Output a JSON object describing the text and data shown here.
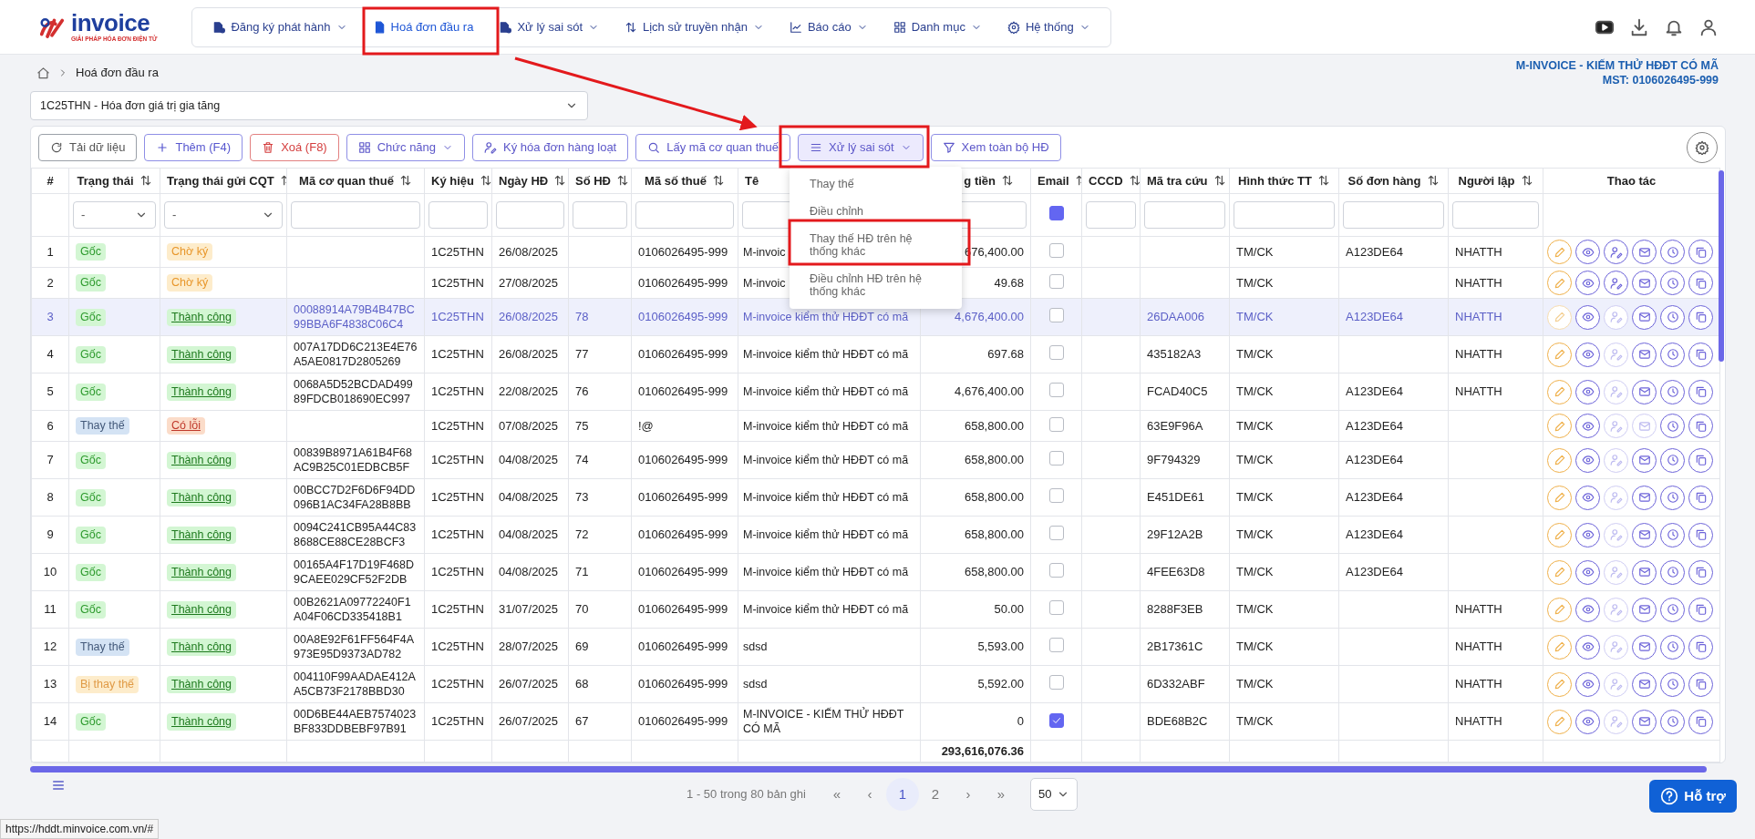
{
  "logo": {
    "name": "invoice",
    "tagline": "GIẢI PHÁP HÓA ĐƠN ĐIỆN TỬ"
  },
  "nav": [
    {
      "label": "Đăng ký phát hành",
      "caret": true,
      "selected": false
    },
    {
      "label": "Hoá đơn đầu ra",
      "caret": false,
      "selected": true
    },
    {
      "label": "Xử lý sai sót",
      "caret": true,
      "selected": false
    },
    {
      "label": "Lịch sử truyền nhận",
      "caret": true,
      "selected": false
    },
    {
      "label": "Báo cáo",
      "caret": true,
      "selected": false
    },
    {
      "label": "Danh mục",
      "caret": true,
      "selected": false
    },
    {
      "label": "Hệ thống",
      "caret": true,
      "selected": false
    }
  ],
  "breadcrumb": [
    "Hoá đơn đầu ra"
  ],
  "company": {
    "name": "M-INVOICE - KIẾM THỬ HĐĐT CÓ MÃ",
    "tax_id": "MST: 0106026495-999"
  },
  "series_select": {
    "value": "1C25THN - Hóa đơn giá trị gia tăng"
  },
  "toolbar": [
    {
      "label": "Tải dữ liệu",
      "kind": "reload"
    },
    {
      "label": "Thêm (F4)",
      "kind": "add"
    },
    {
      "label": "Xoá (F8)",
      "kind": "delete"
    },
    {
      "label": "Chức năng",
      "kind": "functions",
      "expanded": false
    },
    {
      "label": "Ký hóa đơn hàng loạt",
      "kind": "sign"
    },
    {
      "label": "Lấy mã cơ quan thuế",
      "kind": "search"
    },
    {
      "label": "Xử lý sai sót",
      "kind": "errors",
      "expanded": true,
      "menu": [
        "Thay thế",
        "Điều chỉnh",
        "Thay thế HĐ trên hệ thống khác",
        "Điều chỉnh HĐ trên hệ thống khác"
      ]
    },
    {
      "label": "Xem toàn bộ HĐ",
      "kind": "filter"
    }
  ],
  "table": {
    "columns": [
      {
        "label": "#",
        "sortable": false
      },
      {
        "label": "Trạng thái",
        "sortable": true
      },
      {
        "label": "Trạng thái gửi CQT",
        "sortable": true
      },
      {
        "label": "Mã cơ quan thuế",
        "sortable": true
      },
      {
        "label": "Ký hiệu",
        "sortable": true
      },
      {
        "label": "Ngày HĐ",
        "sortable": true
      },
      {
        "label": "Số HĐ",
        "sortable": true
      },
      {
        "label": "Mã số thuế",
        "sortable": true
      },
      {
        "label": "Tê",
        "sortable": false
      },
      {
        "label": "g tiền",
        "sortable": true
      },
      {
        "label": "Email",
        "sortable": true
      },
      {
        "label": "CCCD",
        "sortable": true
      },
      {
        "label": "Mã tra cứu",
        "sortable": true
      },
      {
        "label": "Hình thức TT",
        "sortable": true
      },
      {
        "label": "Số đơn hàng",
        "sortable": true
      },
      {
        "label": "Người lập",
        "sortable": true
      },
      {
        "label": "Thao tác",
        "sortable": false
      }
    ],
    "filters": {
      "status": "-",
      "cqt": "-",
      "email_indeterminate": true
    },
    "rows": [
      {
        "no": "1",
        "selected": false,
        "status": {
          "label": "Gốc",
          "kind": "original"
        },
        "cqt": {
          "label": "Chờ ký",
          "kind": "pending"
        },
        "symbol": "1C25THN",
        "date": "26/08/2025",
        "tax_id": "0106026495-999",
        "name": "M-invoic",
        "amount": "676,400.00",
        "email": false,
        "payment": "TM/CK",
        "order_no": "A123DE64",
        "creator": "NHATTH",
        "edit_disabled": false,
        "sign_disabled": false,
        "email_disabled": false
      },
      {
        "no": "2",
        "selected": false,
        "status": {
          "label": "Gốc",
          "kind": "original"
        },
        "cqt": {
          "label": "Chờ ký",
          "kind": "pending"
        },
        "symbol": "1C25THN",
        "date": "27/08/2025",
        "tax_id": "0106026495-999",
        "name": "M-invoic",
        "amount": "49.68",
        "email": false,
        "payment": "TM/CK",
        "creator": "NHATTH",
        "edit_disabled": false,
        "sign_disabled": false,
        "email_disabled": false
      },
      {
        "no": "3",
        "selected": true,
        "status": {
          "label": "Gốc",
          "kind": "original"
        },
        "cqt": {
          "label": "Thành công",
          "kind": "success"
        },
        "authority_code": "00088914A79B4B47BC99BBA6F4838C06C4",
        "symbol": "1C25THN",
        "date": "26/08/2025",
        "number": "78",
        "tax_id": "0106026495-999",
        "name": "M-invoice kiểm thử HĐĐT có mã",
        "amount": "4,676,400.00",
        "email": false,
        "lookup": "26DAA006",
        "payment": "TM/CK",
        "order_no": "A123DE64",
        "creator": "NHATTH",
        "edit_disabled": true,
        "sign_disabled": true,
        "email_disabled": false
      },
      {
        "no": "4",
        "selected": false,
        "status": {
          "label": "Gốc",
          "kind": "original"
        },
        "cqt": {
          "label": "Thành công",
          "kind": "success"
        },
        "authority_code": "007A17DD6C213E4E76A5AE0817D2805269",
        "symbol": "1C25THN",
        "date": "26/08/2025",
        "number": "77",
        "tax_id": "0106026495-999",
        "name": "M-invoice kiểm thử HĐĐT có mã",
        "amount": "697.68",
        "email": false,
        "lookup": "435182A3",
        "payment": "TM/CK",
        "creator": "NHATTH",
        "edit_disabled": false,
        "sign_disabled": true,
        "email_disabled": false
      },
      {
        "no": "5",
        "selected": false,
        "status": {
          "label": "Gốc",
          "kind": "original"
        },
        "cqt": {
          "label": "Thành công",
          "kind": "success"
        },
        "authority_code": "0068A5D52BCDAD49989FDCB018690EC997",
        "symbol": "1C25THN",
        "date": "22/08/2025",
        "number": "76",
        "tax_id": "0106026495-999",
        "name": "M-invoice kiểm thử HĐĐT có mã",
        "amount": "4,676,400.00",
        "email": false,
        "lookup": "FCAD40C5",
        "payment": "TM/CK",
        "order_no": "A123DE64",
        "creator": "NHATTH",
        "edit_disabled": false,
        "sign_disabled": true,
        "email_disabled": false
      },
      {
        "no": "6",
        "selected": false,
        "status": {
          "label": "Thay thế",
          "kind": "replacement"
        },
        "cqt": {
          "label": "Có lỗi",
          "kind": "error"
        },
        "symbol": "1C25THN",
        "date": "07/08/2025",
        "number": "75",
        "tax_id": "!@",
        "name": "M-invoice kiểm thử HĐĐT có mã",
        "amount": "658,800.00",
        "email": false,
        "lookup": "63E9F96A",
        "payment": "TM/CK",
        "order_no": "A123DE64",
        "edit_disabled": false,
        "sign_disabled": true,
        "email_disabled": true
      },
      {
        "no": "7",
        "selected": false,
        "status": {
          "label": "Gốc",
          "kind": "original"
        },
        "cqt": {
          "label": "Thành công",
          "kind": "success"
        },
        "authority_code": "00839B8971A61B4F68AC9B25C01EDBCB5F",
        "symbol": "1C25THN",
        "date": "04/08/2025",
        "number": "74",
        "tax_id": "0106026495-999",
        "name": "M-invoice kiểm thử HĐĐT có mã",
        "amount": "658,800.00",
        "email": false,
        "lookup": "9F794329",
        "payment": "TM/CK",
        "order_no": "A123DE64",
        "edit_disabled": false,
        "sign_disabled": true,
        "email_disabled": false
      },
      {
        "no": "8",
        "selected": false,
        "status": {
          "label": "Gốc",
          "kind": "original"
        },
        "cqt": {
          "label": "Thành công",
          "kind": "success"
        },
        "authority_code": "00BCC7D2F6D6F94DD096B1AC34FA28B8BB",
        "symbol": "1C25THN",
        "date": "04/08/2025",
        "number": "73",
        "tax_id": "0106026495-999",
        "name": "M-invoice kiểm thử HĐĐT có mã",
        "amount": "658,800.00",
        "email": false,
        "lookup": "E451DE61",
        "payment": "TM/CK",
        "order_no": "A123DE64",
        "edit_disabled": false,
        "sign_disabled": true,
        "email_disabled": false
      },
      {
        "no": "9",
        "selected": false,
        "status": {
          "label": "Gốc",
          "kind": "original"
        },
        "cqt": {
          "label": "Thành công",
          "kind": "success"
        },
        "authority_code": "0094C241CB95A44C838688CE88CE28BCF3",
        "symbol": "1C25THN",
        "date": "04/08/2025",
        "number": "72",
        "tax_id": "0106026495-999",
        "name": "M-invoice kiểm thử HĐĐT có mã",
        "amount": "658,800.00",
        "email": false,
        "lookup": "29F12A2B",
        "payment": "TM/CK",
        "order_no": "A123DE64",
        "edit_disabled": false,
        "sign_disabled": true,
        "email_disabled": false
      },
      {
        "no": "10",
        "selected": false,
        "status": {
          "label": "Gốc",
          "kind": "original"
        },
        "cqt": {
          "label": "Thành công",
          "kind": "success"
        },
        "authority_code": "00165A4F17D19F468D9CAEE029CF52F2DB",
        "symbol": "1C25THN",
        "date": "04/08/2025",
        "number": "71",
        "tax_id": "0106026495-999",
        "name": "M-invoice kiểm thử HĐĐT có mã",
        "amount": "658,800.00",
        "email": false,
        "lookup": "4FEE63D8",
        "payment": "TM/CK",
        "order_no": "A123DE64",
        "edit_disabled": false,
        "sign_disabled": true,
        "email_disabled": false
      },
      {
        "no": "11",
        "selected": false,
        "status": {
          "label": "Gốc",
          "kind": "original"
        },
        "cqt": {
          "label": "Thành công",
          "kind": "success"
        },
        "authority_code": "00B2621A09772240F1A04F06CD335418B1",
        "symbol": "1C25THN",
        "date": "31/07/2025",
        "number": "70",
        "tax_id": "0106026495-999",
        "name": "M-invoice kiểm thử HĐĐT có mã",
        "amount": "50.00",
        "email": false,
        "lookup": "8288F3EB",
        "payment": "TM/CK",
        "creator": "NHATTH",
        "edit_disabled": false,
        "sign_disabled": true,
        "email_disabled": false
      },
      {
        "no": "12",
        "selected": false,
        "status": {
          "label": "Thay thế",
          "kind": "replacement"
        },
        "cqt": {
          "label": "Thành công",
          "kind": "success"
        },
        "authority_code": "00A8E92F61FF564F4A973E95D9373AD782",
        "symbol": "1C25THN",
        "date": "28/07/2025",
        "number": "69",
        "tax_id": "0106026495-999",
        "name": "sdsd",
        "amount": "5,593.00",
        "email": false,
        "lookup": "2B17361C",
        "payment": "TM/CK",
        "creator": "NHATTH",
        "edit_disabled": false,
        "sign_disabled": true,
        "email_disabled": false
      },
      {
        "no": "13",
        "selected": false,
        "status": {
          "label": "Bị thay thế",
          "kind": "replaced"
        },
        "cqt": {
          "label": "Thành công",
          "kind": "success"
        },
        "authority_code": "004110F99AADAE412AA5CB73F2178BBD30",
        "symbol": "1C25THN",
        "date": "26/07/2025",
        "number": "68",
        "tax_id": "0106026495-999",
        "name": "sdsd",
        "amount": "5,592.00",
        "email": false,
        "lookup": "6D332ABF",
        "payment": "TM/CK",
        "creator": "NHATTH",
        "edit_disabled": false,
        "sign_disabled": true,
        "email_disabled": false
      },
      {
        "no": "14",
        "selected": false,
        "status": {
          "label": "Gốc",
          "kind": "original"
        },
        "cqt": {
          "label": "Thành công",
          "kind": "success"
        },
        "authority_code": "00D6BE44AEB7574023BF833DDBEBF97B91",
        "symbol": "1C25THN",
        "date": "26/07/2025",
        "number": "67",
        "tax_id": "0106026495-999",
        "name": "M-INVOICE - KIẾM THỬ HĐĐT CÓ MÃ",
        "amount": "0",
        "email": true,
        "lookup": "BDE68B2C",
        "payment": "TM/CK",
        "creator": "NHATTH",
        "edit_disabled": false,
        "sign_disabled": true,
        "email_disabled": false
      }
    ],
    "total": "293,616,076.36"
  },
  "pagination": {
    "summary": "1 - 50 trong 80 bản ghi",
    "first": "«",
    "prev": "‹",
    "pages": [
      {
        "label": "1",
        "selected": true
      },
      {
        "label": "2",
        "selected": false
      }
    ],
    "next": "›",
    "last": "»",
    "page_size": "50"
  },
  "help_button": "Hỗ trợ",
  "status_url": "https://hddt.minvoice.com.vn/#"
}
